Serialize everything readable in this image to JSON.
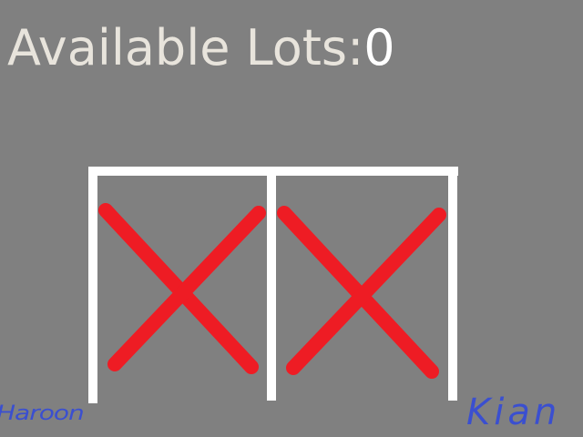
{
  "header": {
    "label": "Available Lots:",
    "count": "0"
  },
  "lots": [
    {
      "name": "lot-1",
      "occupied": true
    },
    {
      "name": "lot-2",
      "occupied": true
    }
  ],
  "signatures": {
    "left": "Haroon",
    "right": "Kian"
  },
  "colors": {
    "background": "#808080",
    "lot_lines": "#ffffff",
    "occupied_mark": "#ee1c24",
    "signature": "#3a4fd0"
  }
}
